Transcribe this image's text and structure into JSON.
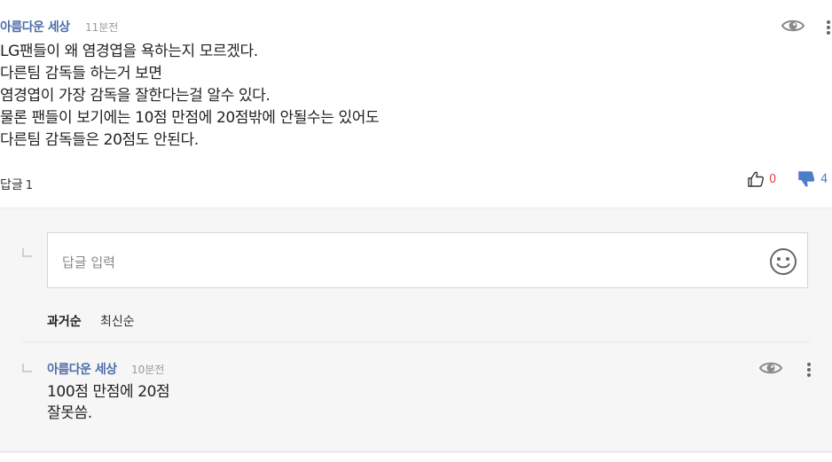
{
  "comment": {
    "author": "아름다운 세상",
    "time": "11분전",
    "lines": [
      "LG팬들이 왜 염경엽을 욕하는지 모르겠다.",
      "다른팀 감독들 하는거 보면",
      "염경엽이 가장 감독을 잘한다는걸 알수 있다.",
      "물론 팬들이 보기에는 10점 만점에 20점밖에 안될수는 있어도",
      "다른팀 감독들은 20점도 안된다."
    ],
    "reply_label": "답글",
    "reply_count": "1",
    "likes": "0",
    "dislikes": "4"
  },
  "reply_box": {
    "placeholder": "답글 입력"
  },
  "sort": {
    "oldest": "과거순",
    "newest": "최신순"
  },
  "reply": {
    "author": "아름다운 세상",
    "time": "10분전",
    "lines": [
      "100점 만점에 20점",
      "잘못씀."
    ]
  },
  "colors": {
    "author": "#4e6ea8",
    "like": "#e0453e",
    "dislike": "#4d7cc9",
    "reply_bg": "#f6f6f6"
  },
  "icons": [
    "eye-icon",
    "more-vertical-icon",
    "thumbs-up-icon",
    "thumbs-down-icon",
    "smiley-icon"
  ]
}
